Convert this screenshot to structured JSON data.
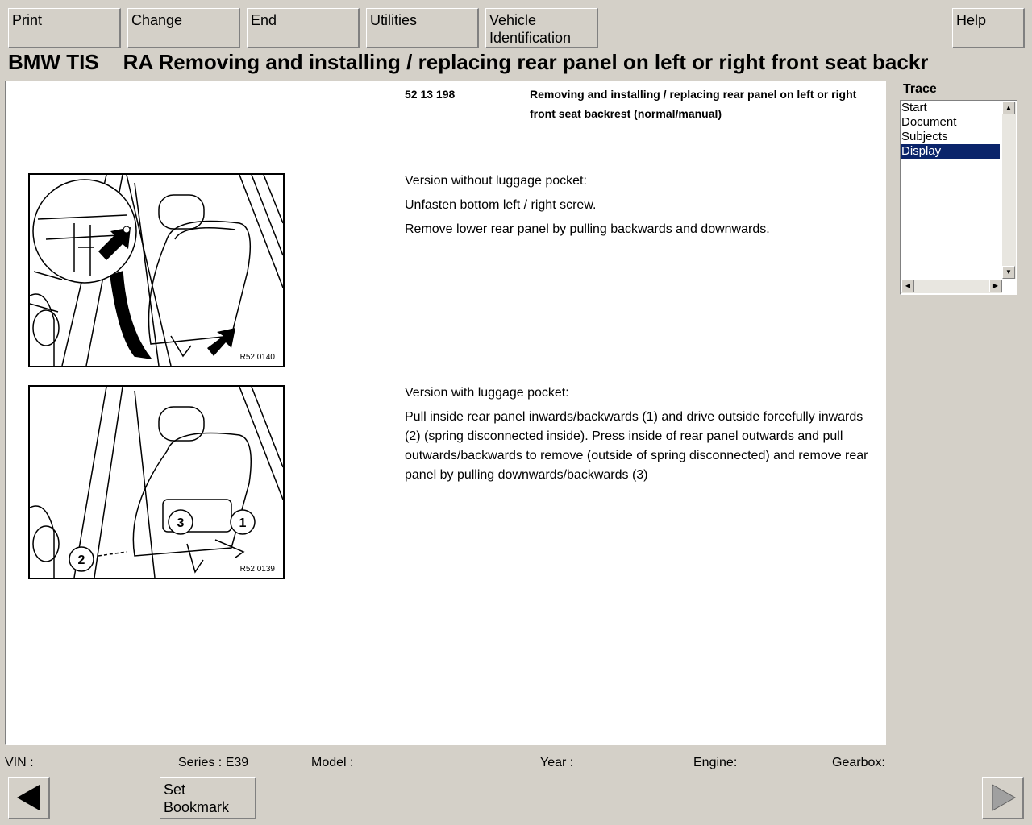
{
  "toolbar": {
    "print": "Print",
    "change": "Change",
    "end": "End",
    "utilities": "Utilities",
    "vehicle_id_line1": "Vehicle",
    "vehicle_id_line2": "Identification",
    "help": "Help"
  },
  "title": {
    "system": "BMW TIS",
    "text": "RA  Removing and installing / replacing rear panel on left or right front seat backr"
  },
  "document": {
    "number": "52 13 198",
    "heading": "Removing and installing / replacing rear panel on left or right front seat backrest (normal/manual)",
    "section1": {
      "figure_label": "R52 0140",
      "lines": [
        "Version without luggage pocket:",
        "Unfasten bottom left / right screw.",
        "Remove lower rear panel by pulling backwards and downwards."
      ]
    },
    "section2": {
      "figure_label": "R52 0139",
      "callouts": [
        "1",
        "2",
        "3"
      ],
      "lines": [
        "Version with luggage pocket:",
        "Pull inside rear panel inwards/backwards (1) and drive outside forcefully inwards (2) (spring disconnected inside). Press inside of rear panel outwards and pull outwards/backwards to remove (outside of spring disconnected) and remove rear panel by pulling downwards/backwards (3)"
      ]
    }
  },
  "trace": {
    "label": "Trace",
    "items": [
      "Start",
      "Document",
      "Subjects",
      "Display"
    ],
    "selected": "Display"
  },
  "status": {
    "vin": "VIN :",
    "series": "Series : E39",
    "model": "Model :",
    "year": "Year :",
    "engine": "Engine:",
    "gearbox": "Gearbox:"
  },
  "bottom": {
    "bookmark_line1": "Set",
    "bookmark_line2": "Bookmark",
    "back_icon": "triangle-left",
    "forward_icon": "triangle-right"
  }
}
